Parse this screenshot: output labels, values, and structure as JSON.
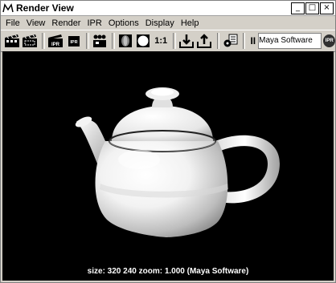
{
  "window": {
    "title": "Render View",
    "controls": {
      "minimize": "_",
      "maximize": "□",
      "close": "×"
    }
  },
  "menubar": [
    "File",
    "View",
    "Render",
    "IPR",
    "Options",
    "Display",
    "Help"
  ],
  "toolbar": {
    "ratio_label": "1:1",
    "pause_label": "II",
    "renderer_field": "Maya Software",
    "ipr_badge": "IPR",
    "icons": [
      "render-frame-icon",
      "render-region-icon",
      "ipr-render-icon",
      "ipr-refresh-icon",
      "snapshot-icon",
      "rgb-channels-icon",
      "alpha-channel-icon",
      "one-to-one-icon",
      "keep-image-icon",
      "remove-image-icon",
      "render-settings-icon",
      "pause-icon",
      "ipr-icon"
    ]
  },
  "viewport": {
    "status_text": "size:  320  240 zoom: 1.000  (Maya Software)"
  }
}
